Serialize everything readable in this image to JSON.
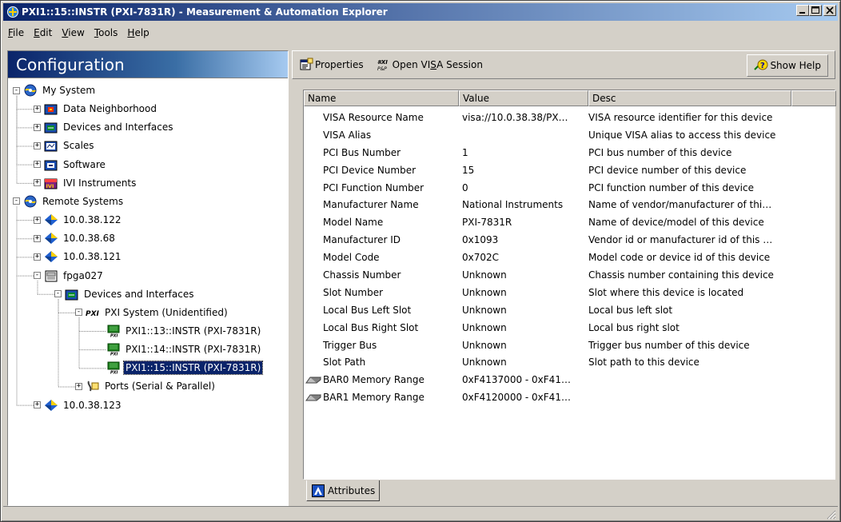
{
  "window": {
    "title": "PXI1::15::INSTR (PXI-7831R) - Measurement & Automation Explorer",
    "buttons": [
      "minimize",
      "maximize",
      "close"
    ]
  },
  "menu": [
    {
      "label": "File",
      "accel": "F",
      "rest": "ile"
    },
    {
      "label": "Edit",
      "accel": "E",
      "rest": "dit"
    },
    {
      "label": "View",
      "accel": "V",
      "rest": "iew"
    },
    {
      "label": "Tools",
      "accel": "T",
      "rest": "ools"
    },
    {
      "label": "Help",
      "accel": "H",
      "rest": "elp"
    }
  ],
  "left_panel": {
    "header": "Configuration",
    "tree": [
      {
        "label": "My System",
        "icon": "system-icon",
        "expander": "-",
        "level": 0
      },
      {
        "label": "Data Neighborhood",
        "icon": "data-neighborhood-icon",
        "expander": "+",
        "level": 1
      },
      {
        "label": "Devices and Interfaces",
        "icon": "devices-icon",
        "expander": "+",
        "level": 1
      },
      {
        "label": "Scales",
        "icon": "scales-icon",
        "expander": "+",
        "level": 1
      },
      {
        "label": "Software",
        "icon": "software-icon",
        "expander": "+",
        "level": 1
      },
      {
        "label": "IVI Instruments",
        "icon": "ivi-icon",
        "expander": "+",
        "level": 1
      },
      {
        "label": "Remote Systems",
        "icon": "remote-systems-icon",
        "expander": "-",
        "level": 0
      },
      {
        "label": "10.0.38.122",
        "icon": "remote-host-icon",
        "expander": "+",
        "level": 1
      },
      {
        "label": "10.0.38.68",
        "icon": "remote-host-icon",
        "expander": "+",
        "level": 1
      },
      {
        "label": "10.0.38.121",
        "icon": "remote-host-icon",
        "expander": "+",
        "level": 1
      },
      {
        "label": "fpga027",
        "icon": "fpga-target-icon",
        "expander": "-",
        "level": 1
      },
      {
        "label": "Devices and Interfaces",
        "icon": "devices-icon",
        "expander": "-",
        "level": 2
      },
      {
        "label": "PXI System (Unidentified)",
        "icon": "pxi-icon",
        "expander": "-",
        "level": 3
      },
      {
        "label": "PXI1::13::INSTR (PXI-7831R)",
        "icon": "pxi-device-icon",
        "expander": "",
        "level": 4
      },
      {
        "label": "PXI1::14::INSTR (PXI-7831R)",
        "icon": "pxi-device-icon",
        "expander": "",
        "level": 4
      },
      {
        "label": "PXI1::15::INSTR (PXI-7831R)",
        "icon": "pxi-device-icon",
        "expander": "",
        "level": 4,
        "selected": true
      },
      {
        "label": "Ports (Serial & Parallel)",
        "icon": "ports-icon",
        "expander": "+",
        "level": 3
      },
      {
        "label": "10.0.38.123",
        "icon": "remote-host-icon",
        "expander": "+",
        "level": 1
      }
    ]
  },
  "toolbar": {
    "properties_label": "Properties",
    "visa_label": "Open VISA Session",
    "visa_accel": "S",
    "help_label": "Show Help"
  },
  "grid": {
    "columns": [
      "Name",
      "Value",
      "Desc"
    ],
    "rows": [
      {
        "name": "VISA Resource Name",
        "value": "visa://10.0.38.38/PX…",
        "desc": "VISA resource identifier for this device"
      },
      {
        "name": "VISA Alias",
        "value": "",
        "desc": "Unique VISA alias to access this device"
      },
      {
        "name": "PCI Bus Number",
        "value": "1",
        "desc": "PCI bus number of this device"
      },
      {
        "name": "PCI Device Number",
        "value": "15",
        "desc": "PCI device number of this device"
      },
      {
        "name": "PCI Function Number",
        "value": "0",
        "desc": "PCI function number of this device"
      },
      {
        "name": "Manufacturer Name",
        "value": "National Instruments",
        "desc": "Name of vendor/manufacturer of thi…"
      },
      {
        "name": "Model Name",
        "value": "PXI-7831R",
        "desc": "Name of device/model of this device"
      },
      {
        "name": "Manufacturer ID",
        "value": "0x1093",
        "desc": "Vendor id or manufacturer id of this …"
      },
      {
        "name": "Model Code",
        "value": "0x702C",
        "desc": "Model code or device id of this device"
      },
      {
        "name": "Chassis Number",
        "value": "Unknown",
        "desc": "Chassis number containing this device"
      },
      {
        "name": "Slot Number",
        "value": "Unknown",
        "desc": "Slot where this device is located"
      },
      {
        "name": "Local Bus Left Slot",
        "value": "Unknown",
        "desc": "Local bus left slot"
      },
      {
        "name": "Local Bus Right Slot",
        "value": "Unknown",
        "desc": "Local bus right slot"
      },
      {
        "name": "Trigger Bus",
        "value": "Unknown",
        "desc": "Trigger bus number of this device"
      },
      {
        "name": "Slot Path",
        "value": "Unknown",
        "desc": "Slot path to this device"
      },
      {
        "name": "BAR0 Memory Range",
        "value": "0xF4137000 - 0xF41…",
        "desc": "",
        "icon": "memory-icon"
      },
      {
        "name": "BAR1 Memory Range",
        "value": "0xF4120000 - 0xF41…",
        "desc": "",
        "icon": "memory-icon"
      }
    ]
  },
  "tabs": [
    {
      "label": "Attributes",
      "icon": "attributes-icon"
    }
  ],
  "colors": {
    "title_start": "#0a246a",
    "title_end": "#a6caf0",
    "face": "#d4d0c8",
    "selection": "#0a246a"
  }
}
